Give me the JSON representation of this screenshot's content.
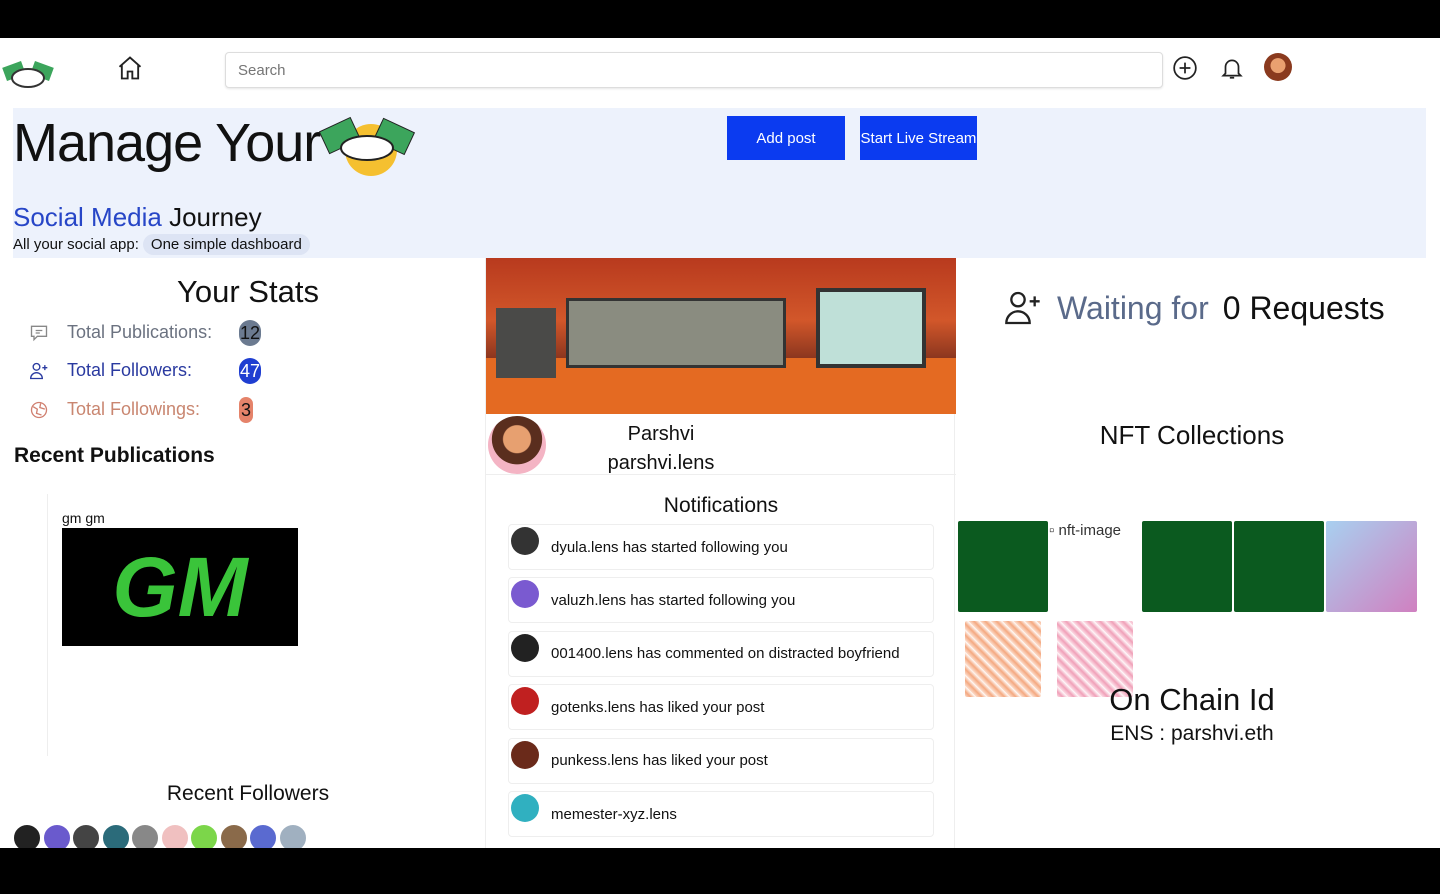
{
  "header": {
    "search_placeholder": "Search"
  },
  "hero": {
    "title": "Manage Your",
    "subtitle_highlight": "Social Media",
    "subtitle_rest": " Journey",
    "tagline": "All your social app:",
    "tagline_chip": "One simple dashboard",
    "add_post": "Add post",
    "live_stream": "Start Live Stream"
  },
  "stats": {
    "title": "Your Stats",
    "items": [
      {
        "label": "Total Publications:",
        "value": "12",
        "color": "#6b7280",
        "badge": "#6b7a90",
        "icon": "chat-icon"
      },
      {
        "label": "Total Followers:",
        "value": "47",
        "color": "#2a3aa0",
        "badge": "#1f3ed1",
        "icon": "user-plus-icon"
      },
      {
        "label": "Total Followings:",
        "value": "3",
        "color": "#c98670",
        "badge": "#e5836a",
        "icon": "globe-icon"
      }
    ]
  },
  "recent_publications": {
    "title": "Recent Publications",
    "posts": [
      {
        "text": "gm gm",
        "image_text": "GM"
      }
    ]
  },
  "recent_followers": {
    "title": "Recent Followers",
    "avatar_colors": [
      "#222",
      "#6a5acd",
      "#444",
      "#2b6b7a",
      "#888",
      "#f0c0c0",
      "#7cd64a",
      "#8a6a4a",
      "#5a6ad0",
      "#a0b0c0"
    ]
  },
  "profile": {
    "name": "Parshvi",
    "handle": "parshvi.lens"
  },
  "notifications": {
    "title": "Notifications",
    "items": [
      {
        "text": "dyula.lens has started following you",
        "color": "#333"
      },
      {
        "text": "valuzh.lens has started following you",
        "color": "#7a5ad0"
      },
      {
        "text": "001400.lens has commented on distracted boyfriend",
        "color": "#222"
      },
      {
        "text": "gotenks.lens has liked your post",
        "color": "#c02020"
      },
      {
        "text": "punkess.lens has liked your post",
        "color": "#6a2a1a"
      },
      {
        "text": "memester-xyz.lens",
        "color": "#30b0c0"
      }
    ]
  },
  "requests": {
    "prefix": "Waiting for",
    "count": "0 Requests"
  },
  "nft": {
    "title": "NFT Collections",
    "broken_alt": "nft-image"
  },
  "chain": {
    "title": "On Chain Id",
    "ens": "ENS : parshvi.eth"
  }
}
